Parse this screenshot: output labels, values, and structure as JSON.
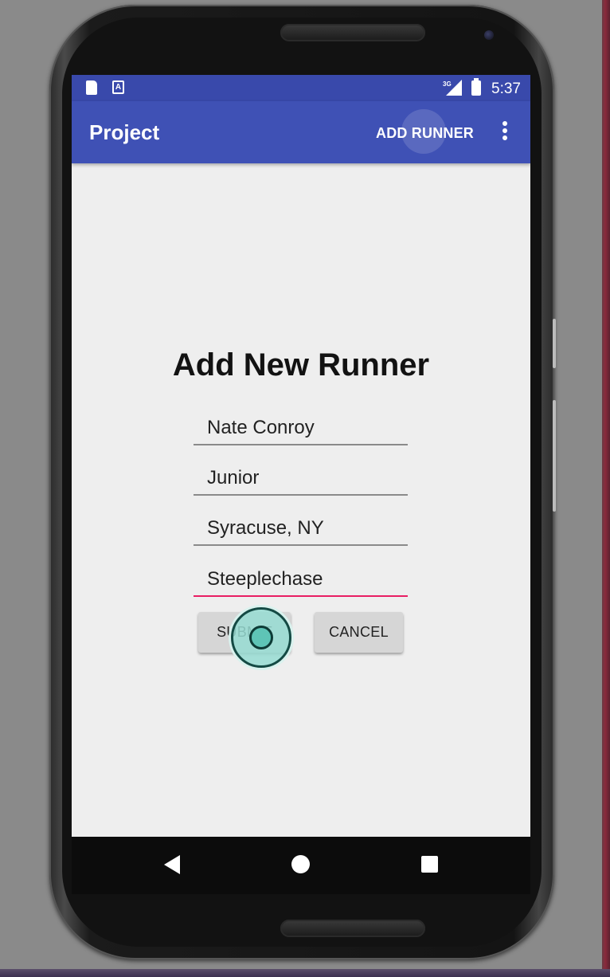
{
  "status_bar": {
    "sd_icon": "sd-card-icon",
    "a_icon_label": "A",
    "network_type": "3G",
    "signal_icon": "cell-signal-icon",
    "battery_icon": "battery-charging-icon",
    "time": "5:37"
  },
  "app_bar": {
    "title": "Project",
    "action_label": "ADD RUNNER",
    "overflow_icon": "more-vert-icon"
  },
  "form": {
    "title": "Add New Runner",
    "fields": [
      {
        "value": "Nate Conroy"
      },
      {
        "value": "Junior"
      },
      {
        "value": "Syracuse, NY"
      },
      {
        "value": "Steeplechase"
      }
    ],
    "submit_label": "SUBMIT",
    "cancel_label": "CANCEL"
  },
  "nav_bar": {
    "back_icon": "back-triangle-icon",
    "home_icon": "home-circle-icon",
    "recents_icon": "recents-square-icon"
  },
  "colors": {
    "primary": "#3f51b5",
    "primary_dark": "#3949ab",
    "accent": "#e91e63",
    "background": "#eeeeee"
  }
}
